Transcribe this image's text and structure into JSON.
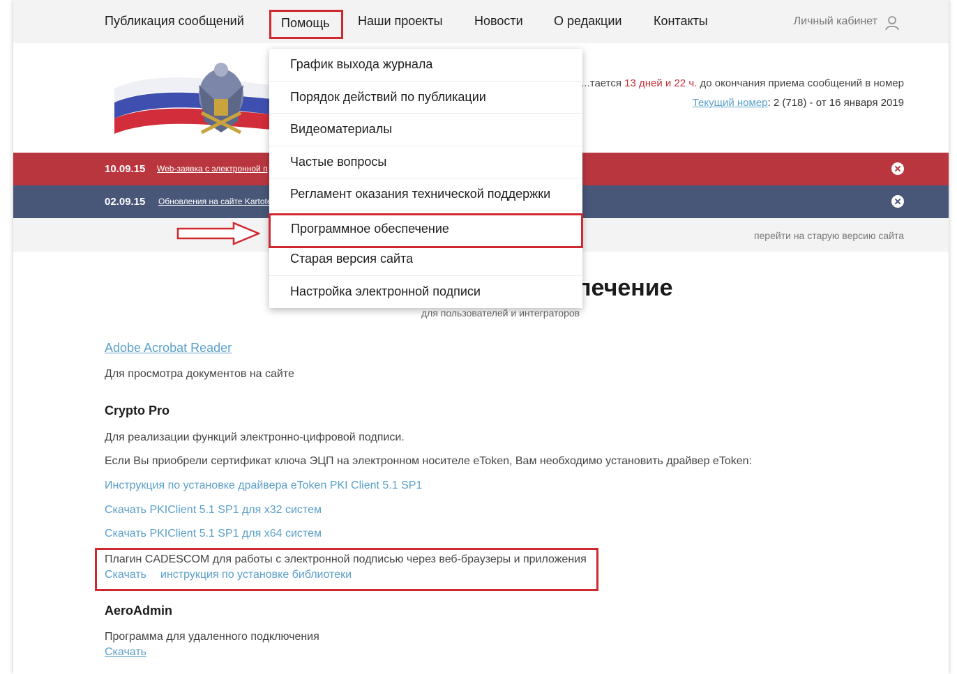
{
  "nav": {
    "items": [
      "Публикация сообщений",
      "Помощь",
      "Наши проекты",
      "Новости",
      "О редакции",
      "Контакты"
    ],
    "account": "Личный кабинет"
  },
  "header": {
    "deadline_prefix": "...тается",
    "deadline_value": "13 дней и 22 ч.",
    "deadline_suffix": "до окончания приема сообщений в номер",
    "issue_link": "Текущий номер",
    "issue_value": ": 2 (718) - от 16 января 2019"
  },
  "news": [
    {
      "date": "10.09.15",
      "text": "Web-заявка с электронной п"
    },
    {
      "date": "02.09.15",
      "text": "Обновления на сайте Kartote"
    }
  ],
  "old_site_link": "перейти на старую версию сайта",
  "dropdown": {
    "items": [
      "График выхода журнала",
      "Порядок действий по публикации",
      "Видеоматериалы",
      "Частые вопросы",
      "Регламент оказания технической поддержки",
      "Программное обеспечение",
      "Старая версия сайта",
      "Настройка электронной подписи"
    ],
    "highlighted_index": 5
  },
  "main": {
    "title": "печение",
    "subtitle": "для пользователей и интеграторов",
    "adobe_link": "Adobe Acrobat Reader",
    "adobe_desc": "Для просмотра документов на сайте",
    "crypto_head": "Crypto Pro",
    "crypto_desc1": "Для реализации функций электронно-цифровой подписи.",
    "crypto_desc2": "Если Вы приобрели сертификат ключа ЭЦП на электронном носителе eToken, Вам необходимо установить драйвер eToken:",
    "etoken_instr": "Инструкция по установке драйвера eToken PKI Client 5.1 SP1",
    "pki_x32": "Скачать PKIClient 5.1 SP1 для x32 систем",
    "pki_x64": "Скачать PKIClient 5.1 SP1 для x64 систем",
    "cades_desc": "Плагин CADESCOM для работы с электронной подписью через веб-браузеры и приложения",
    "cades_download": "Скачать",
    "cades_instr": "инструкция по установке библиотеки",
    "aero_head": "AeroAdmin",
    "aero_desc": "Программа для удаленного подключения",
    "aero_download": "Скачать"
  },
  "colors": {
    "accent_red": "#d0282f",
    "bar_red": "#b9363f",
    "bar_blue": "#485677",
    "link_blue": "#5a9fc9"
  }
}
